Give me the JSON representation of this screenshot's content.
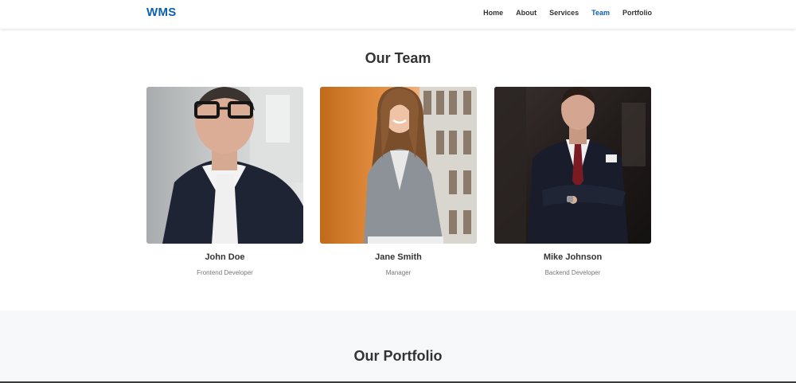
{
  "brand": "WMS",
  "nav": {
    "items": [
      {
        "label": "Home"
      },
      {
        "label": "About"
      },
      {
        "label": "Services"
      },
      {
        "label": "Team"
      },
      {
        "label": "Portfolio"
      }
    ],
    "active": "Team"
  },
  "team": {
    "title": "Our Team",
    "members": [
      {
        "name": "John Doe",
        "role": "Frontend Developer"
      },
      {
        "name": "Jane Smith",
        "role": "Manager"
      },
      {
        "name": "Mike Johnson",
        "role": "Backend Developer"
      }
    ]
  },
  "portfolio": {
    "title": "Our Portfolio"
  },
  "colors": {
    "accent": "#0d5fb0",
    "text": "#333333",
    "muted": "#777777",
    "section_bg": "#f7f8fa"
  }
}
